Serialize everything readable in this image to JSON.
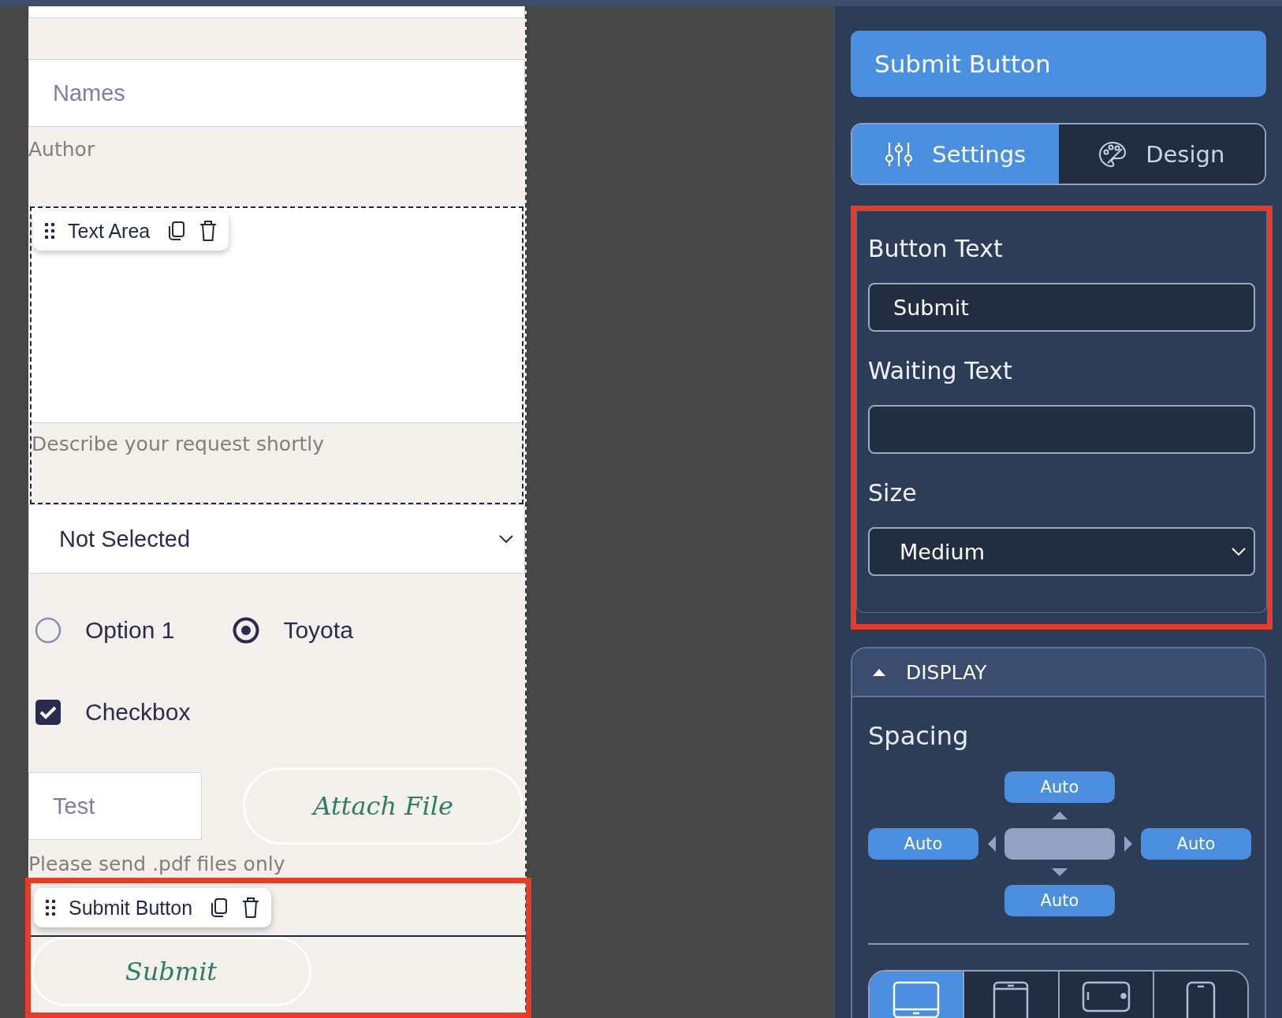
{
  "form": {
    "names_field": {
      "placeholder": "Names"
    },
    "author_label": "Author",
    "text_area": {
      "toolbar_label": "Text Area",
      "helper": "Describe your request shortly"
    },
    "select": {
      "value": "Not Selected"
    },
    "radios": [
      {
        "label": "Option 1",
        "selected": false
      },
      {
        "label": "Toyota",
        "selected": true
      }
    ],
    "checkbox": {
      "label": "Checkbox",
      "checked": true
    },
    "file_field": {
      "placeholder": "Test"
    },
    "attach_button": "Attach File",
    "file_helper": "Please send .pdf files only",
    "submit": {
      "toolbar_label": "Submit Button",
      "label": "Submit"
    }
  },
  "panel": {
    "title": "Submit Button",
    "tabs": [
      {
        "label": "Settings",
        "selected": true
      },
      {
        "label": "Design",
        "selected": false
      }
    ],
    "button_text": {
      "label": "Button Text",
      "value": "Submit"
    },
    "waiting_text": {
      "label": "Waiting Text"
    },
    "size": {
      "label": "Size",
      "value": "Medium"
    },
    "display": {
      "title": "DISPLAY",
      "expanded": true,
      "spacing_label": "Spacing",
      "top": "Auto",
      "left": "Auto",
      "right": "Auto",
      "bottom": "Auto"
    },
    "devices": [
      {
        "kind": "desktop",
        "selected": true
      },
      {
        "kind": "tablet",
        "selected": false
      },
      {
        "kind": "tablet_landscape",
        "selected": false
      },
      {
        "kind": "phone",
        "selected": false
      }
    ]
  }
}
